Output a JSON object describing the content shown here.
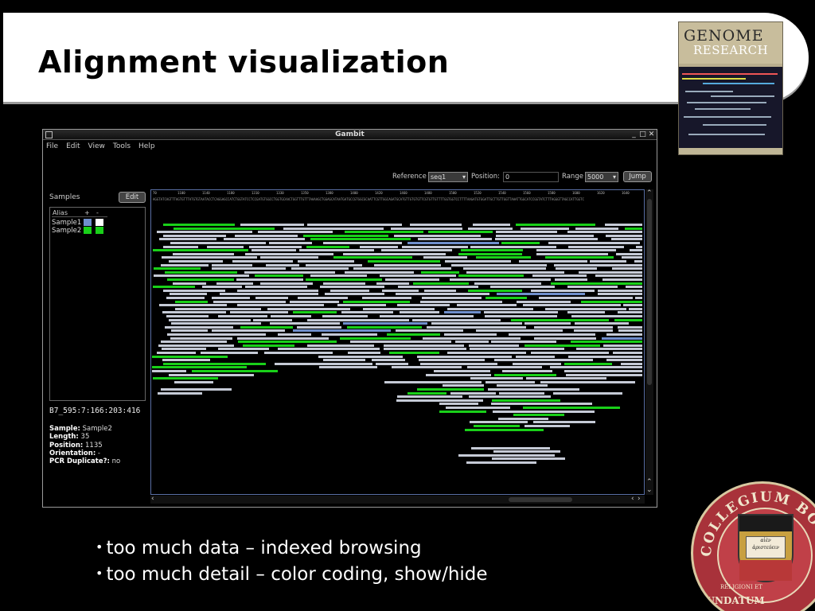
{
  "slide": {
    "title": "Alignment visualization",
    "bullets": [
      "too much data – indexed browsing",
      "too much detail – color coding, show/hide"
    ]
  },
  "journal": {
    "line1": "GENOME",
    "line2": "RESEARCH"
  },
  "window": {
    "title": "Gambit",
    "controls": [
      "_",
      "□",
      "✕"
    ]
  },
  "menu": [
    "File",
    "Edit",
    "View",
    "Tools",
    "Help"
  ],
  "toolbar": {
    "reference_label": "Reference",
    "reference_value": "seq1",
    "position_label": "Position:",
    "position_value": "0",
    "range_label": "Range",
    "range_value": "5000",
    "jump_label": "Jump"
  },
  "samples": {
    "label": "Samples",
    "edit_label": "Edit",
    "header_alias": "Alias",
    "header_plus": "+",
    "header_minus": "-",
    "rows": [
      {
        "alias": "Sample1",
        "plus_color": "#6f8fcc",
        "minus_color": "#ffffff"
      },
      {
        "alias": "Sample2",
        "plus_color": "#19d019",
        "minus_color": "#19d019"
      }
    ]
  },
  "details": {
    "read_id": "B7_595:7:166:203:416",
    "sample_label": "Sample:",
    "sample_value": "Sample2",
    "length_label": "Length:",
    "length_value": "35",
    "position_label": "Position:",
    "position_value": "1135",
    "orientation_label": "Orientation:",
    "orientation_value": "-",
    "pcr_label": "PCR Duplicate?:",
    "pcr_value": "no"
  },
  "ruler": {
    "ticks": [
      "70",
      "1100",
      "1140",
      "1180",
      "1310",
      "1330",
      "1350",
      "1380",
      "1400",
      "1420",
      "1460",
      "1480",
      "1500",
      "1520",
      "1540",
      "1560",
      "1580",
      "1600",
      "1620",
      "1640"
    ],
    "reference_sequence": "AGGTATCAGTTTAGTGTTTATGTGTAATACCTCAGGAGCCATCTGGTATCCTCCGATGTGGCCTGGTGCAACTGGTTTGTTTAAAAGCTGGAGCATAATGATGCCGTGGCGCAATTCGTTGGCAGATGCATGTTGTGTGTTCGTGTTGTTTTGGTGGTCCTTTTAAGATGTGGATTGCTTGTTGGTTAAATTGGCATCCGGTATCTTTAGGGTTAGCCATTGGTC"
  },
  "colors": {
    "read_default": "#c5cad6",
    "read_highlight": "#19d019",
    "read_selected": "#6f8fcc"
  },
  "seal": {
    "text_top": "COLLEGIUM BOSTON",
    "text_bottom": "FUNDATUM",
    "motto": "αἰὲν ἀριστεύειν",
    "book_text": "αἰὲν ἀριστεύειν",
    "ribbon": "RELIGIONI ET"
  }
}
